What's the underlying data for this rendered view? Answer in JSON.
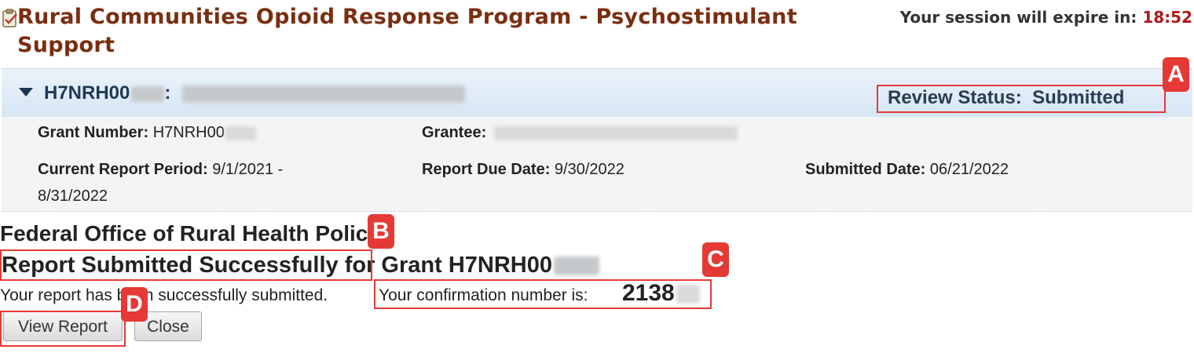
{
  "header": {
    "title": "Rural Communities Opioid Response Program - Psychostimulant Support",
    "session_label": "Your session will expire in:",
    "session_timer": "18:52",
    "icon": "clipboard-check-icon"
  },
  "grant_panel": {
    "grant_id_prefix": "H7NRH00",
    "separator": ":",
    "review_status_label": "Review Status:",
    "review_status_value": "Submitted",
    "fields": {
      "grant_number_label": "Grant Number:",
      "grant_number_value": "H7NRH00",
      "grantee_label": "Grantee:",
      "current_period_label": "Current Report Period:",
      "current_period_value": "9/1/2021 -",
      "current_period_value_2": "8/31/2022",
      "due_date_label": "Report Due Date:",
      "due_date_value": "9/30/2022",
      "submitted_date_label": "Submitted Date:",
      "submitted_date_value": "06/21/2022"
    }
  },
  "confirmation": {
    "office": "Federal Office of Rural Health Policy",
    "success_title": "Report Submitted Successfully for Grant H7NRH00",
    "message": "Your report has been successfully submitted.",
    "confirmation_label": "Your confirmation number is:",
    "confirmation_number": "2138"
  },
  "buttons": {
    "view_report": "View Report",
    "close": "Close"
  },
  "callouts": [
    "A",
    "B",
    "C",
    "D"
  ],
  "colors": {
    "title": "#7a2e10",
    "timer": "#b01818",
    "callout": "#e53935",
    "panel_header": "#d6e6f4"
  }
}
